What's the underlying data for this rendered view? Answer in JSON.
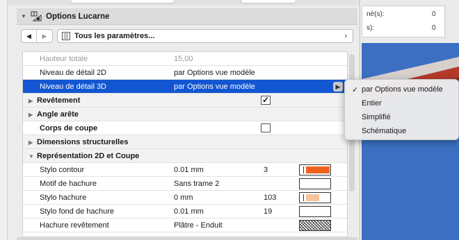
{
  "palette": {
    "title": "Options Lucarne"
  },
  "nav": {
    "selector_label": "Tous les paramètres...",
    "prev_arrow": "◀",
    "next_arrow": "▶",
    "chevron": "›"
  },
  "background": {
    "row1_label": "né(s):",
    "row1_value": "0",
    "row2_label": "s):",
    "row2_value": "0"
  },
  "rows": {
    "hauteur": {
      "name": "Hauteur totale",
      "value": "15,00"
    },
    "niv2d": {
      "name": "Niveau de détail 2D",
      "value": "par Options vue modèle"
    },
    "niv3d": {
      "name": "Niveau de détail 3D",
      "value": "par Options vue modèle"
    },
    "revetement": {
      "name": "Revêtement",
      "checked": true,
      "check_glyph": "✓"
    },
    "angle": {
      "name": "Angle arête"
    },
    "corps": {
      "name": "Corps de coupe",
      "checked": false
    },
    "dimensions": {
      "name": "Dimensions structurelles"
    },
    "rep": {
      "name": "Représentation 2D et Coupe"
    },
    "stylo_contour": {
      "name": "Stylo contour",
      "value": "0.01 mm",
      "num": "3",
      "color": "#f0621b",
      "fill": 1.0
    },
    "motif": {
      "name": "Motif de hachure",
      "value": "Sans trame 2"
    },
    "stylo_hachure": {
      "name": "Stylo hachure",
      "value": "0 mm",
      "num": "103",
      "color": "#f7c39a",
      "fill": 0.55
    },
    "stylo_fond": {
      "name": "Stylo fond de hachure",
      "value": "0.01 mm",
      "num": "19"
    },
    "hachure_rev": {
      "name": "Hachure revêtement",
      "value": "Plâtre - Enduit"
    }
  },
  "menu": {
    "check_glyph": "✓",
    "items": [
      "par Options vue modèle",
      "Entier",
      "Simplifié",
      "Schématique"
    ],
    "selected_index": 0
  },
  "colors": {
    "selection": "#1256d1",
    "scene_blue": "#3c6fc2",
    "beam_red": "#c0392b"
  }
}
